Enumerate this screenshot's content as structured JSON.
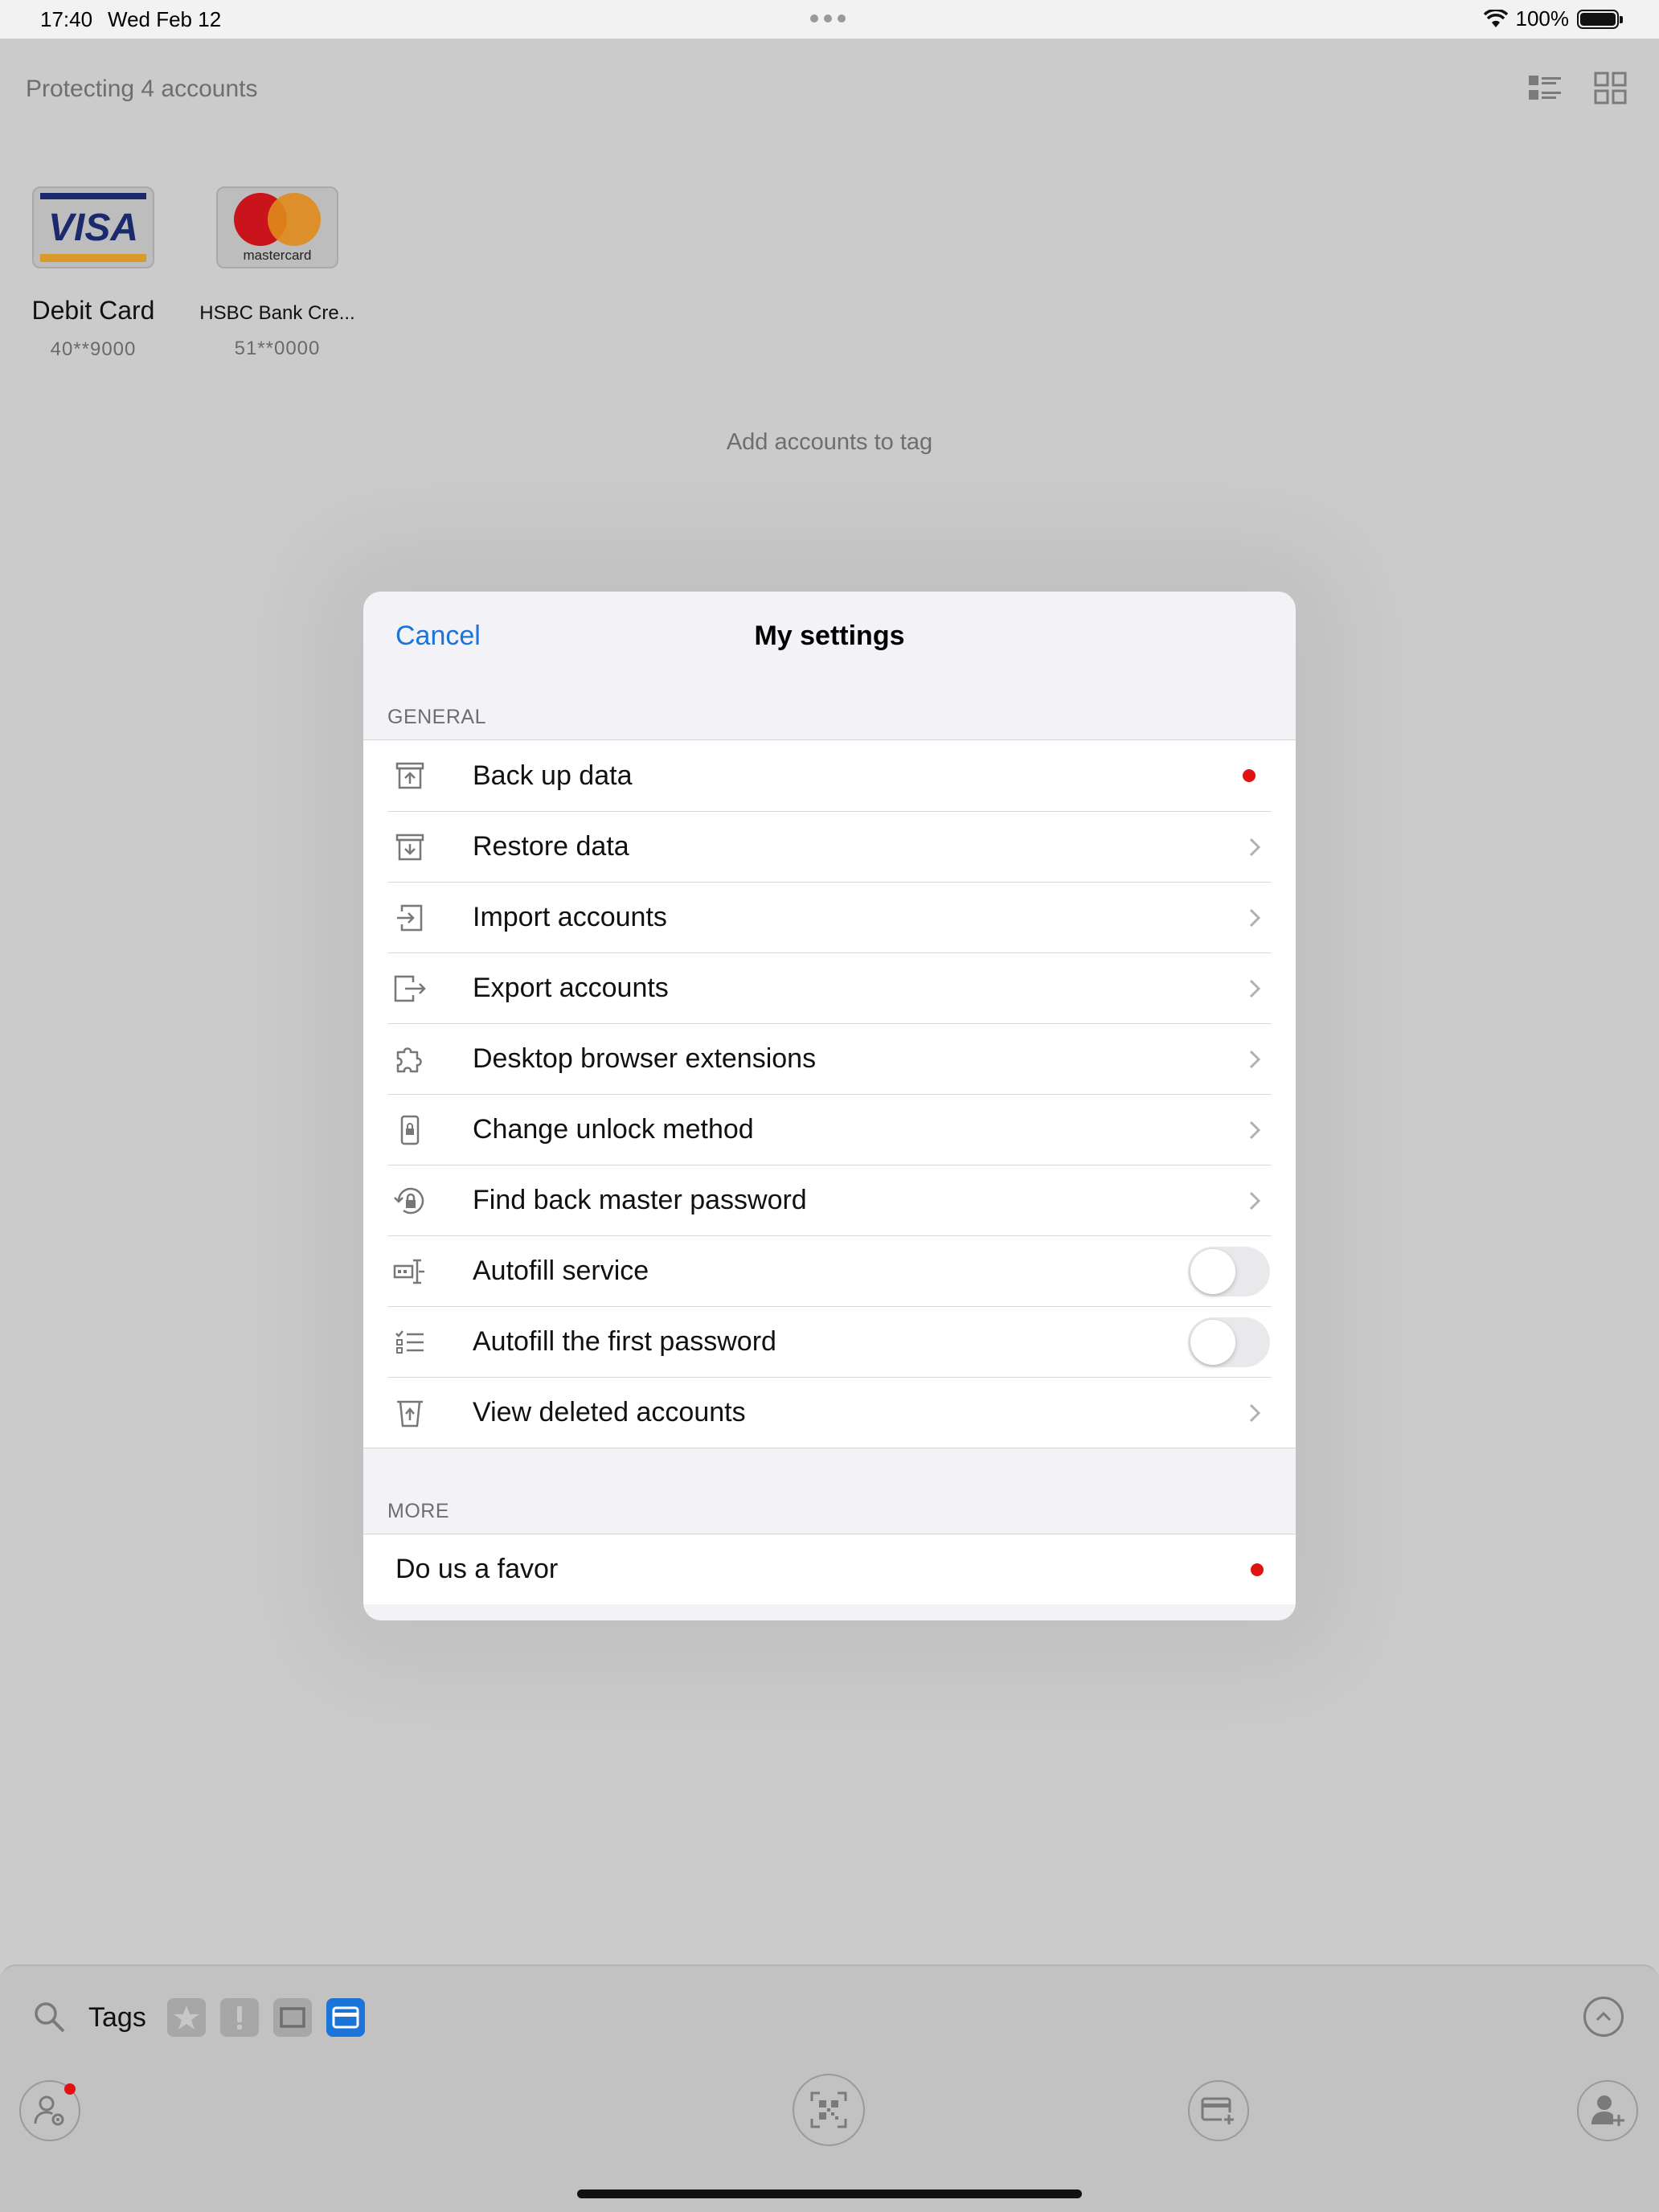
{
  "status_bar": {
    "time": "17:40",
    "date": "Wed Feb 12",
    "battery": "100%"
  },
  "background": {
    "header_text": "Protecting 4 accounts",
    "cards": [
      {
        "logo": "visa-logo",
        "logo_text": "VISA",
        "name": "Debit Card",
        "number": "40**9000"
      },
      {
        "logo": "mastercard-logo",
        "logo_text": "mastercard",
        "name": "HSBC Bank Cre...",
        "number": "51**0000"
      }
    ],
    "add_accounts_text": "Add accounts to tag"
  },
  "modal": {
    "cancel_label": "Cancel",
    "title": "My settings",
    "general_header": "GENERAL",
    "general_items": [
      {
        "label": "Back up data",
        "icon": "backup-icon",
        "accessory": "red-dot"
      },
      {
        "label": "Restore data",
        "icon": "restore-icon",
        "accessory": "chevron"
      },
      {
        "label": "Import accounts",
        "icon": "import-icon",
        "accessory": "chevron"
      },
      {
        "label": "Export accounts",
        "icon": "export-icon",
        "accessory": "chevron"
      },
      {
        "label": "Desktop browser extensions",
        "icon": "puzzle-icon",
        "accessory": "chevron"
      },
      {
        "label": "Change unlock method",
        "icon": "phone-lock-icon",
        "accessory": "chevron"
      },
      {
        "label": "Find back master password",
        "icon": "lock-reset-icon",
        "accessory": "chevron"
      },
      {
        "label": "Autofill service",
        "icon": "autofill-icon",
        "accessory": "toggle",
        "on": false
      },
      {
        "label": "Autofill the first password",
        "icon": "checklist-icon",
        "accessory": "toggle",
        "on": false
      },
      {
        "label": "View deleted accounts",
        "icon": "trash-icon",
        "accessory": "chevron"
      }
    ],
    "more_header": "MORE",
    "more_items": [
      {
        "label": "Do us a favor",
        "accessory": "red-dot"
      }
    ]
  },
  "bottom_bar": {
    "tags_label": "Tags",
    "tag_chips": [
      "star-icon",
      "exclamation-icon",
      "square-icon",
      "card-icon"
    ],
    "active_tag": "card-icon"
  },
  "colors": {
    "accent": "#1b74d8",
    "alert": "#e01212",
    "modal_bg": "#f2f2f7",
    "dimmed_bg": "#cbcbcb"
  }
}
